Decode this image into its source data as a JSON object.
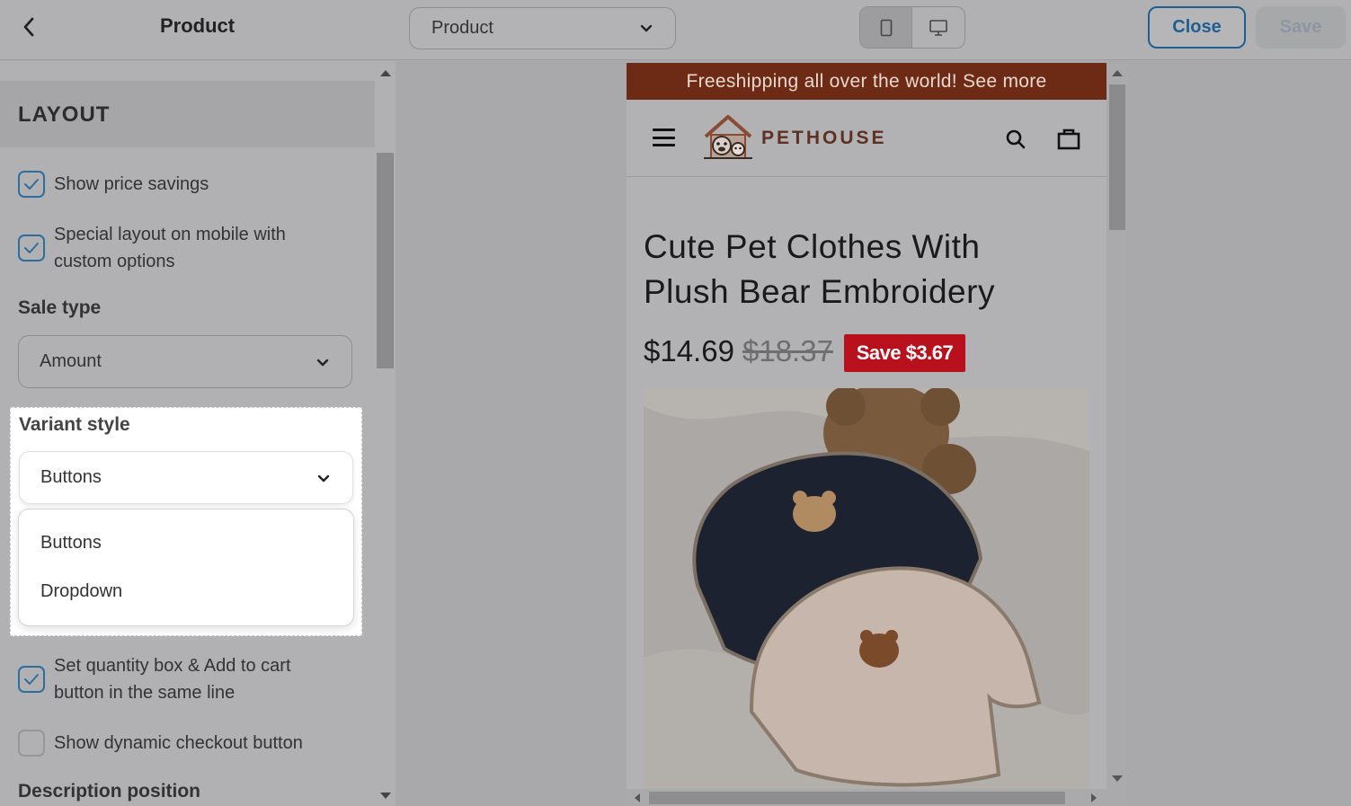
{
  "topbar": {
    "title": "Product",
    "page_select": "Product",
    "close_label": "Close",
    "save_label": "Save"
  },
  "panel": {
    "layout_header": "LAYOUT",
    "options": [
      {
        "label": "Show price savings",
        "checked": true
      },
      {
        "label": "Special layout on mobile with custom options",
        "checked": true
      },
      {
        "label": "Set quantity box & Add to cart button in the same line",
        "checked": true
      },
      {
        "label": "Show dynamic checkout button",
        "checked": false
      }
    ],
    "sale_type": {
      "label": "Sale type",
      "value": "Amount"
    },
    "variant_style": {
      "label": "Variant style",
      "value": "Buttons",
      "options": [
        "Buttons",
        "Dropdown"
      ]
    },
    "description_position": {
      "label": "Description position"
    }
  },
  "preview": {
    "announcement": "Freeshipping all over the world! See more",
    "brand": "PETHOUSE",
    "product_title": "Cute Pet Clothes With Plush Bear Embroidery",
    "price": "$14.69",
    "compare_price": "$18.37",
    "save_badge": "Save $3.67"
  },
  "colors": {
    "accent": "#1f5f8f",
    "announcement_bg": "#6d2b16",
    "save_badge_bg": "#b8101d"
  }
}
